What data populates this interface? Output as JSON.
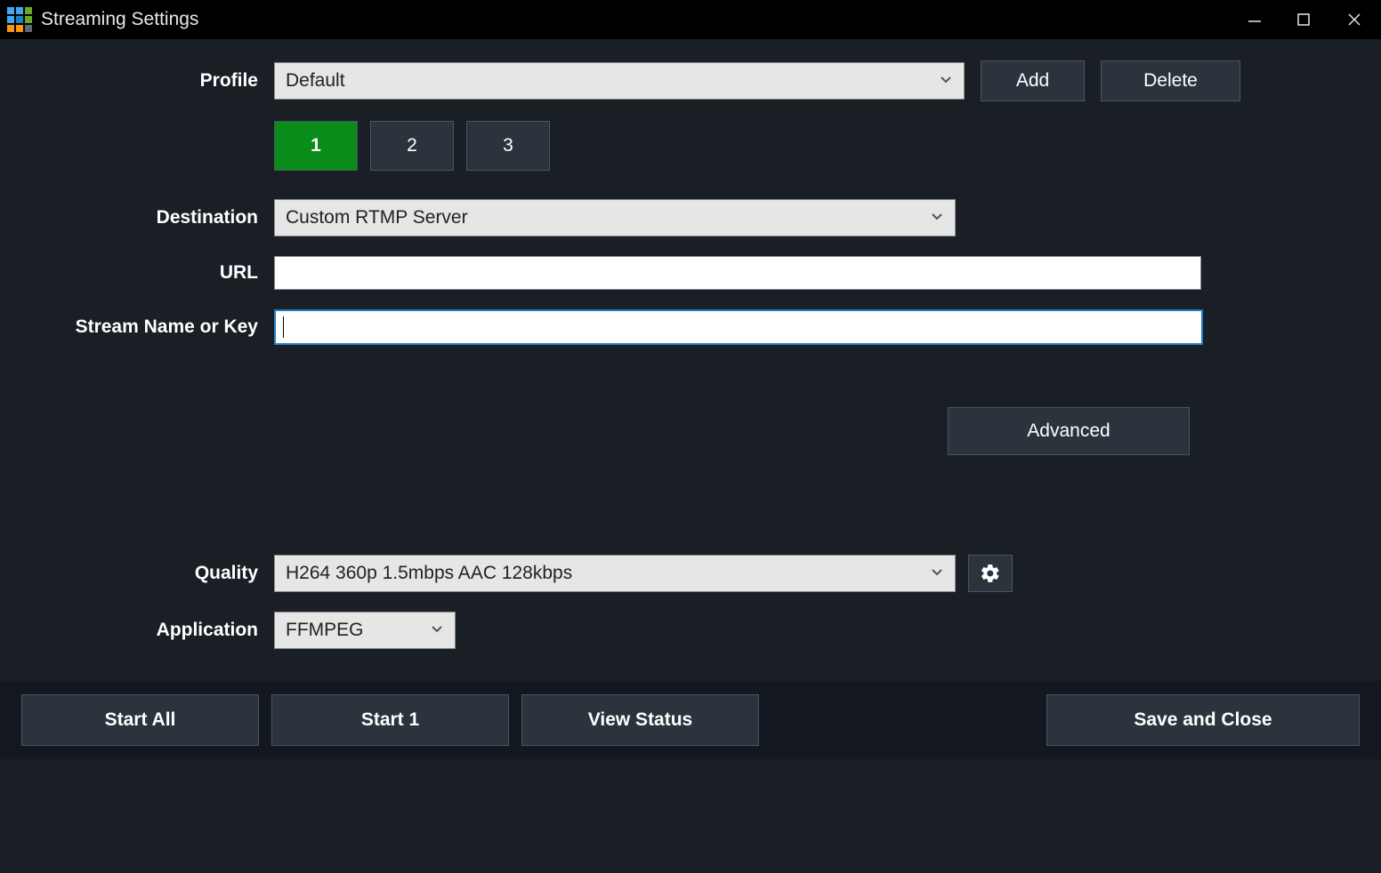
{
  "window": {
    "title": "Streaming Settings"
  },
  "profile": {
    "label": "Profile",
    "selected": "Default",
    "add_label": "Add",
    "delete_label": "Delete"
  },
  "tabs": {
    "items": [
      "1",
      "2",
      "3"
    ],
    "active_index": 0
  },
  "destination": {
    "label": "Destination",
    "selected": "Custom RTMP Server"
  },
  "url": {
    "label": "URL",
    "value": ""
  },
  "stream_key": {
    "label": "Stream Name or Key",
    "value": ""
  },
  "advanced": {
    "label": "Advanced"
  },
  "quality": {
    "label": "Quality",
    "selected": "H264 360p 1.5mbps AAC 128kbps",
    "gear_icon": "gear"
  },
  "application": {
    "label": "Application",
    "selected": "FFMPEG"
  },
  "footer": {
    "start_all": "Start All",
    "start_1": "Start 1",
    "view_status": "View Status",
    "save_close": "Save and Close"
  }
}
